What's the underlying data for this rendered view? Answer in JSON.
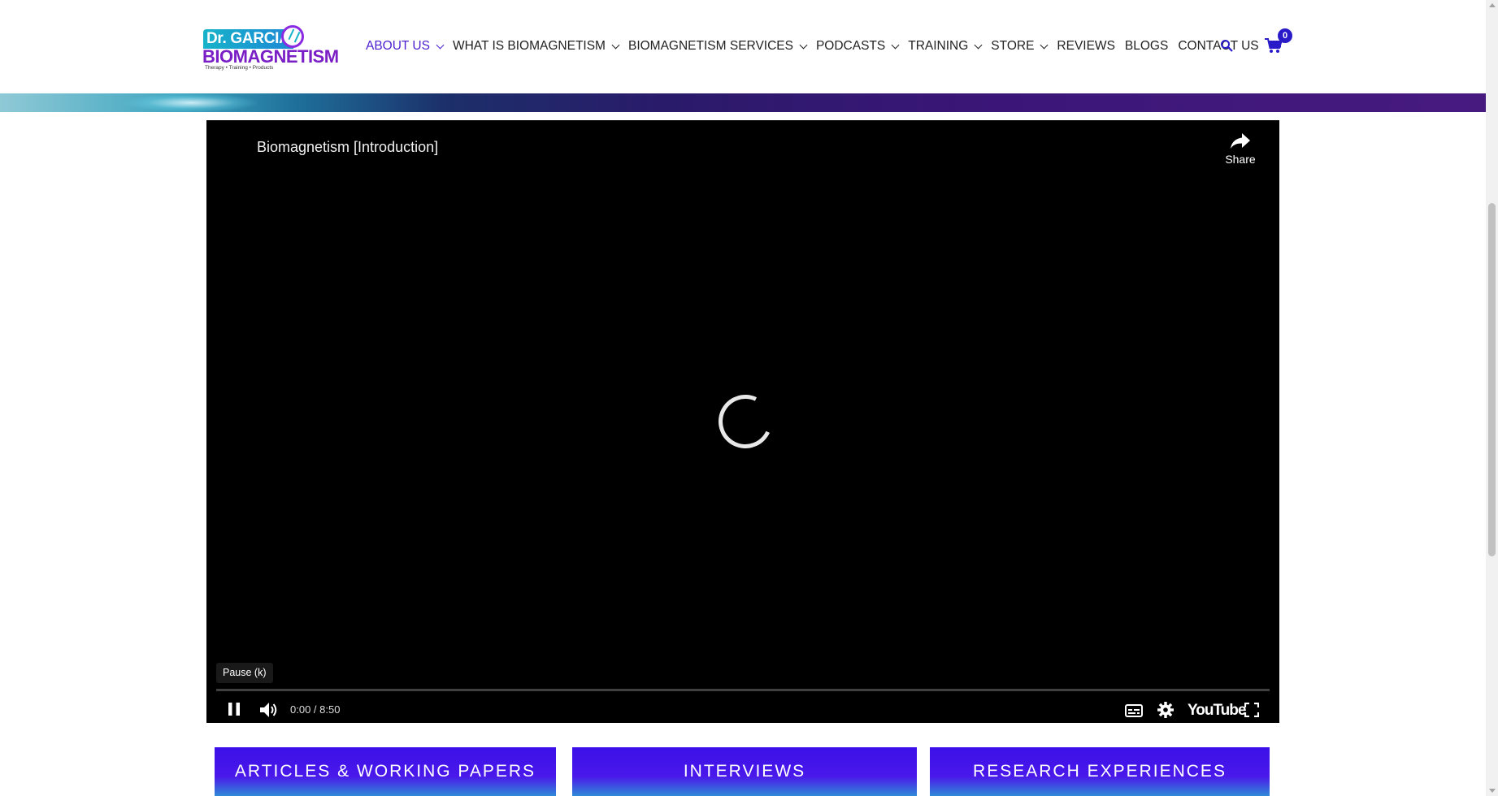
{
  "brand": {
    "logo_top": "Dr. GARCIA",
    "logo_main": "BIOMAGNETISM",
    "logo_tagline": "Therapy • Training • Products",
    "accent_color": "#4b1fd0",
    "card_color": "#3b10e8"
  },
  "nav": {
    "items": [
      {
        "label": "ABOUT US",
        "has_dropdown": true,
        "active": true
      },
      {
        "label": "WHAT IS BIOMAGNETISM",
        "has_dropdown": true
      },
      {
        "label": "BIOMAGNETISM SERVICES",
        "has_dropdown": true
      },
      {
        "label": "PODCASTS",
        "has_dropdown": true
      },
      {
        "label": "TRAINING",
        "has_dropdown": true
      },
      {
        "label": "STORE",
        "has_dropdown": true
      },
      {
        "label": "REVIEWS",
        "has_dropdown": false
      },
      {
        "label": "BLOGS",
        "has_dropdown": false
      },
      {
        "label": "CONTACT US",
        "has_dropdown": false
      }
    ],
    "search_icon": "search-icon",
    "cart_icon": "cart-icon",
    "cart_count": "0"
  },
  "video": {
    "title": "Biomagnetism [Introduction]",
    "share_label": "Share",
    "tooltip": "Pause (k)",
    "time": "0:00 / 8:50",
    "progress": 0,
    "youtube_label": "YouTube",
    "icons": [
      "share-icon",
      "loading-spinner",
      "pause-icon",
      "volume-icon",
      "subtitles-icon",
      "settings-icon",
      "youtube-logo",
      "fullscreen-icon"
    ]
  },
  "cards": [
    {
      "label": "ARTICLES & WORKING PAPERS"
    },
    {
      "label": "INTERVIEWS"
    },
    {
      "label": "RESEARCH EXPERIENCES"
    }
  ]
}
